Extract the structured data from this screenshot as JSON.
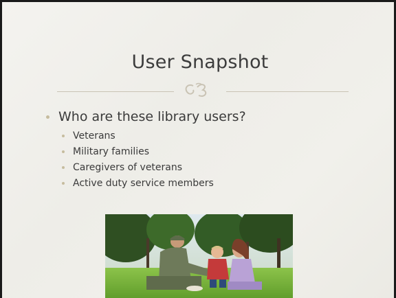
{
  "slide": {
    "title": "User Snapshot",
    "main_bullet": "Who are these library users?",
    "sub_bullets": [
      "Veterans",
      "Military families",
      "Caregivers of veterans",
      "Active duty service members"
    ]
  },
  "colors": {
    "background": "#efeee9",
    "title_text": "#3c3c3c",
    "bullet_accent": "#c6bc9e",
    "ornament": "#c9c3b4",
    "frame_border": "#1a1a1a"
  },
  "icons": {
    "ornament": "scroll-flourish-icon"
  }
}
